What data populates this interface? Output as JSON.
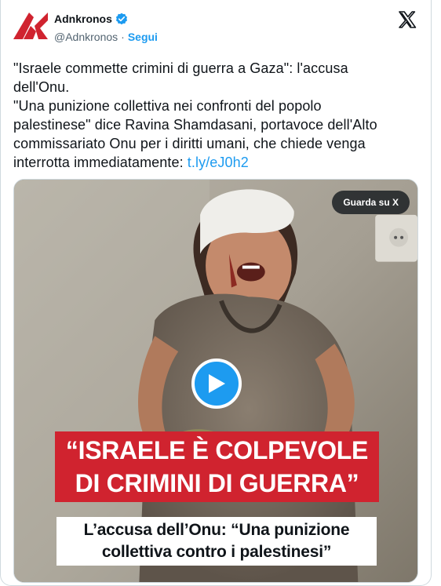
{
  "header": {
    "author_name": "Adnkronos",
    "handle": "@Adnkronos",
    "separator": "·",
    "follow_label": "Segui",
    "logo_icon": "adnkronos-logo",
    "verified_icon": "verified-badge-icon",
    "platform_icon": "x-logo-icon"
  },
  "tweet": {
    "line1": "\"Israele commette crimini di guerra a Gaza\": l'accusa",
    "line2": "dell'Onu.",
    "line3": "\"Una punizione collettiva nei confronti del popolo",
    "line4": "palestinese\" dice Ravina Shamdasani, portavoce dell'Alto",
    "line5": "commissariato Onu per i diritti umani, che chiede venga",
    "line6_text": "interrotta immediatamente: ",
    "link": "t.ly/eJ0h2"
  },
  "media": {
    "watch_label": "Guarda su X",
    "play_icon": "play-icon",
    "headline_line1": "“ISRAELE È COLPEVOLE",
    "headline_line2": "DI CRIMINI DI GUERRA”",
    "subtitle_line1": "L’accusa dell’Onu: “Una punizione",
    "subtitle_line2": "collettiva contro i palestinesi”"
  },
  "colors": {
    "accent": "#1d9bf0",
    "logo_red": "#d0232f",
    "text": "#0f1419",
    "muted": "#536471"
  }
}
